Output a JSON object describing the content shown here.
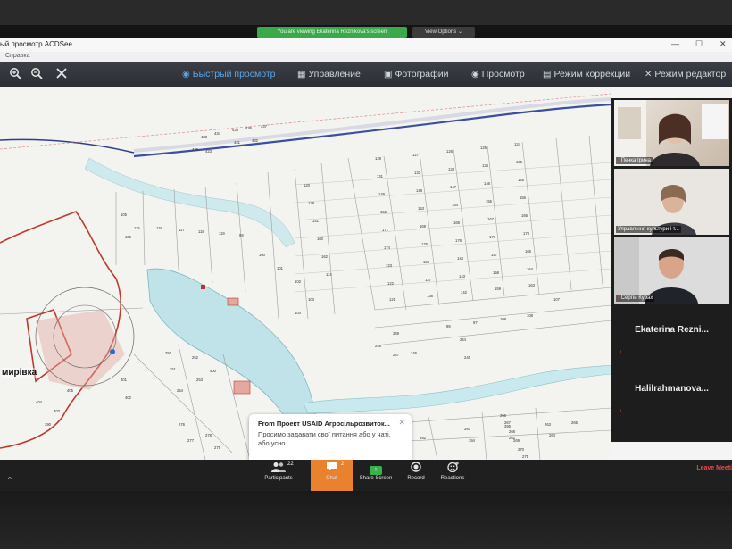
{
  "share_banner": {
    "text": "You are viewing Ekaterina Reznikova's screen",
    "view_options": "View Options ⌄"
  },
  "window": {
    "title": "ый просмотр ACDSee",
    "menu_help": "Справка",
    "controls": {
      "minimize": "—",
      "maximize": "☐",
      "close": "✕"
    }
  },
  "toolbar": {
    "icons": {
      "zoom_in": "zoom-in-icon",
      "zoom_out": "zoom-out-icon",
      "close": "close-icon"
    },
    "modes": [
      {
        "label": "Быстрый просмотр",
        "icon": "eye-icon",
        "active": true
      },
      {
        "label": "Управление",
        "icon": "grid-icon",
        "active": false
      },
      {
        "label": "Фотографии",
        "icon": "photos-icon",
        "active": false
      },
      {
        "label": "Просмотр",
        "icon": "eye-icon",
        "active": false
      },
      {
        "label": "Режим коррекции",
        "icon": "sliders-icon",
        "active": false
      },
      {
        "label": "Режим редактор",
        "icon": "tools-icon",
        "active": false
      }
    ]
  },
  "map": {
    "place_label": "мирівка",
    "parcels": [
      {
        "label": "433"
      },
      {
        "label": "434"
      },
      {
        "label": "435"
      },
      {
        "label": "436"
      },
      {
        "label": "437"
      },
      {
        "label": "429"
      },
      {
        "label": "423"
      },
      {
        "label": "431"
      },
      {
        "label": "432"
      },
      {
        "label": "128"
      },
      {
        "label": "131"
      },
      {
        "label": "149"
      },
      {
        "label": "152"
      },
      {
        "label": "171"
      },
      {
        "label": "174"
      },
      {
        "label": "127"
      },
      {
        "label": "132"
      },
      {
        "label": "148"
      },
      {
        "label": "153"
      },
      {
        "label": "169"
      },
      {
        "label": "175"
      },
      {
        "label": "126"
      },
      {
        "label": "133"
      },
      {
        "label": "147"
      },
      {
        "label": "154"
      },
      {
        "label": "168"
      },
      {
        "label": "176"
      },
      {
        "label": "125"
      },
      {
        "label": "134"
      },
      {
        "label": "146"
      },
      {
        "label": "155"
      },
      {
        "label": "167"
      },
      {
        "label": "177"
      },
      {
        "label": "124"
      },
      {
        "label": "135"
      },
      {
        "label": "145"
      },
      {
        "label": "156"
      },
      {
        "label": "166"
      },
      {
        "label": "178"
      },
      {
        "label": "123"
      },
      {
        "label": "136"
      },
      {
        "label": "144"
      },
      {
        "label": "157"
      },
      {
        "label": "165"
      },
      {
        "label": "122"
      },
      {
        "label": "137"
      },
      {
        "label": "143"
      },
      {
        "label": "158"
      },
      {
        "label": "164"
      },
      {
        "label": "121"
      },
      {
        "label": "138"
      },
      {
        "label": "142"
      },
      {
        "label": "159"
      },
      {
        "label": "163"
      },
      {
        "label": "120"
      },
      {
        "label": "139"
      },
      {
        "label": "141"
      },
      {
        "label": "160"
      },
      {
        "label": "162"
      },
      {
        "label": "114"
      },
      {
        "label": "115"
      },
      {
        "label": "116"
      },
      {
        "label": "117"
      },
      {
        "label": "118"
      },
      {
        "label": "119"
      },
      {
        "label": "99"
      },
      {
        "label": "100"
      },
      {
        "label": "101"
      },
      {
        "label": "102"
      },
      {
        "label": "103"
      },
      {
        "label": "104"
      },
      {
        "label": "105"
      },
      {
        "label": "106"
      },
      {
        "label": "107"
      },
      {
        "label": "108"
      },
      {
        "label": "109"
      },
      {
        "label": "97"
      },
      {
        "label": "98"
      },
      {
        "label": "244"
      },
      {
        "label": "245"
      },
      {
        "label": "246"
      },
      {
        "label": "247"
      },
      {
        "label": "248"
      },
      {
        "label": "249"
      },
      {
        "label": "250"
      },
      {
        "label": "251"
      },
      {
        "label": "252"
      },
      {
        "label": "253"
      },
      {
        "label": "254"
      },
      {
        "label": "400"
      },
      {
        "label": "401"
      },
      {
        "label": "402"
      },
      {
        "label": "403"
      },
      {
        "label": "404"
      },
      {
        "label": "405"
      },
      {
        "label": "390"
      },
      {
        "label": "391"
      },
      {
        "label": "392"
      },
      {
        "label": "393"
      },
      {
        "label": "394"
      },
      {
        "label": "395"
      },
      {
        "label": "262"
      },
      {
        "label": "263"
      },
      {
        "label": "264"
      },
      {
        "label": "265"
      },
      {
        "label": "266"
      },
      {
        "label": "267"
      },
      {
        "label": "268"
      },
      {
        "label": "269"
      },
      {
        "label": "270"
      },
      {
        "label": "275"
      },
      {
        "label": "276"
      },
      {
        "label": "277"
      },
      {
        "label": "278"
      },
      {
        "label": "279"
      },
      {
        "label": "280"
      },
      {
        "label": "422"
      },
      {
        "label": "423"
      },
      {
        "label": "424"
      },
      {
        "label": "425"
      }
    ]
  },
  "participants_panel": {
    "video_tiles": [
      {
        "name": "Печка Ірина",
        "muted": true
      },
      {
        "name": "Управління культури і т...",
        "muted": false
      },
      {
        "name": "Сергій Кубах",
        "muted": true
      }
    ],
    "name_tiles": [
      {
        "name": "Ekaterina  Rezni...",
        "muted": true
      },
      {
        "name": "Halilrahmanova...",
        "muted": true
      }
    ]
  },
  "chat_toast": {
    "title": "From Проект USAID Агросільрозвиток...",
    "body": "Просимо  задавати  свої питання або у чаті, або усно",
    "close": "✕"
  },
  "controlbar": {
    "participants": {
      "label": "Participants",
      "count": "22"
    },
    "chat": {
      "label": "Chat",
      "count": "2"
    },
    "share": {
      "label": "Share Screen",
      "glyph": "↑"
    },
    "record": {
      "label": "Record"
    },
    "reactions": {
      "label": "Reactions"
    },
    "leave": "Leave Meeti",
    "chevron": "^"
  },
  "colors": {
    "accent_active": "#5aa6ea",
    "chat_orange": "#e8822e",
    "share_green": "#37b24d",
    "leave_red": "#e34b4b",
    "banner_green": "#3aa94a",
    "water": "#bfe3e8",
    "road_red": "#c0392b",
    "road_blue": "#3b4fa0"
  }
}
